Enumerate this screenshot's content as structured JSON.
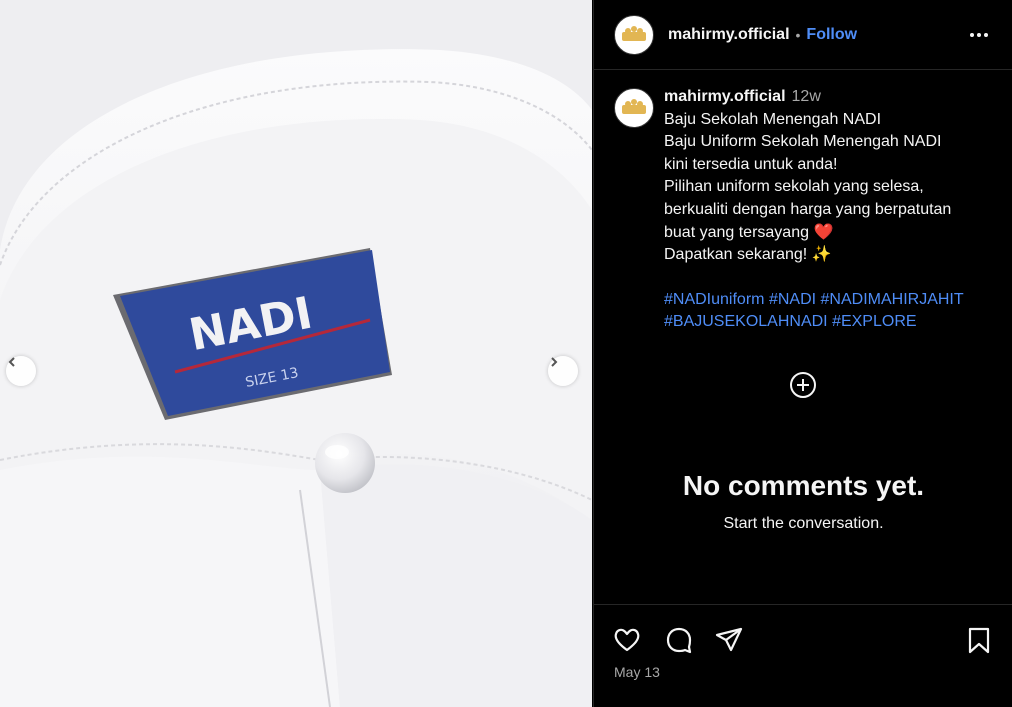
{
  "media": {
    "label_brand": "NADI",
    "label_size": "SIZE 13",
    "prev_icon": "chevron-left-icon",
    "next_icon": "chevron-right-icon"
  },
  "header": {
    "username": "mahirmy.official",
    "separator": "•",
    "follow_label": "Follow",
    "more_icon": "more-horizontal-icon"
  },
  "caption": {
    "username": "mahirmy.official",
    "time": "12w",
    "lines": [
      "Baju Sekolah Menengah NADI",
      "Baju Uniform Sekolah Menengah NADI",
      "kini tersedia untuk anda!",
      "Pilihan uniform sekolah yang selesa,",
      "berkualiti dengan harga yang berpatutan",
      "buat yang tersayang ❤️",
      "Dapatkan sekarang! ✨"
    ],
    "hashtags_line1": [
      "#NADIuniform",
      "#NADI",
      "#NADIMAHIRJAHIT"
    ],
    "hashtags_line2": [
      "#BAJUSEKOLAHNADI",
      "#EXPLORE"
    ]
  },
  "comments": {
    "empty_title": "No comments yet.",
    "empty_subtitle": "Start the conversation."
  },
  "footer": {
    "date": "May 13"
  },
  "colors": {
    "link": "#4f8df7",
    "background": "#000000",
    "label_blue": "#2f4a9c",
    "heart": "#e0245e"
  }
}
